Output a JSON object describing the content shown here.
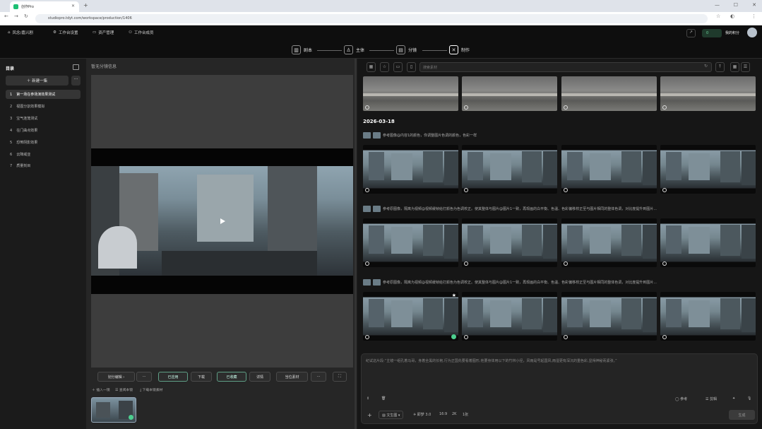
{
  "browser": {
    "tab_title": "创作Pro",
    "url": "studiopro.tdyt.com/workspace/production/1406"
  },
  "header": {
    "logo": "凤念/嘉兴剧",
    "nav": [
      "工作台设置",
      "资产管理",
      "工作台成员"
    ],
    "credits": "0",
    "user_label": "我的积分"
  },
  "steps": [
    {
      "label": "剧本"
    },
    {
      "label": "主体"
    },
    {
      "label": "分镜"
    },
    {
      "label": "制作"
    }
  ],
  "sidebar": {
    "title": "目录",
    "new_episode": "新建一集",
    "more": "···",
    "episodes": [
      {
        "num": "1",
        "title": "第一场在参场演效果测试"
      },
      {
        "num": "2",
        "title": "视图分割效果模拟"
      },
      {
        "num": "3",
        "title": "宝气连笼测试"
      },
      {
        "num": "4",
        "title": "在门曲点效果"
      },
      {
        "num": "5",
        "title": "恐怖阴影效果"
      },
      {
        "num": "6",
        "title": "云降威亚"
      },
      {
        "num": "7",
        "title": "质量刻目"
      }
    ]
  },
  "middle": {
    "title": "暂无分镜信息",
    "toolbar": [
      "划分编辑 ›",
      "···",
      "已应用",
      "下载",
      "已收藏",
      "详情",
      "当位素材",
      "···"
    ],
    "bottom_links": [
      "插入一镜",
      "查阅本镜",
      "下载本镜素材"
    ]
  },
  "right": {
    "search_placeholder": "搜索素材",
    "date": "2026-03-18",
    "prompts": [
      "参考图像@内容1的颜色，你调整图片色调的颜色，色彩一样",
      "参考原图像，隔离为视频@视频缓帧给打颜色为色调校正。使其整体与图片@图片1一致，再现画的白平衡、色温、色彩偏移校正至与图片相同的整体色调，对比度提升到图片...",
      "参考原图像，隔离为视频@视频缓帧给打颜色为色调校正。使其整体与图片@图片1一致，再现画的白平衡、色温、色彩偏移校正至与图片相同的整体色调，对比度提升到图片..."
    ],
    "composer_text": "纪试这片段:“主镜一组孔着马哥，身着全黑的长袍,行为正国先要看着图形,他要身体用以下的竹林小径，风雨是号起国风,雨湿更有深沉的重色彩,显得神秘而紧张。”",
    "composer": {
      "ref": "参考",
      "film": "剪辑",
      "mode": "文生图",
      "model": "即梦 3.0",
      "ratio": "16:9",
      "res": "2K",
      "count": "1张",
      "send": "生成"
    }
  }
}
